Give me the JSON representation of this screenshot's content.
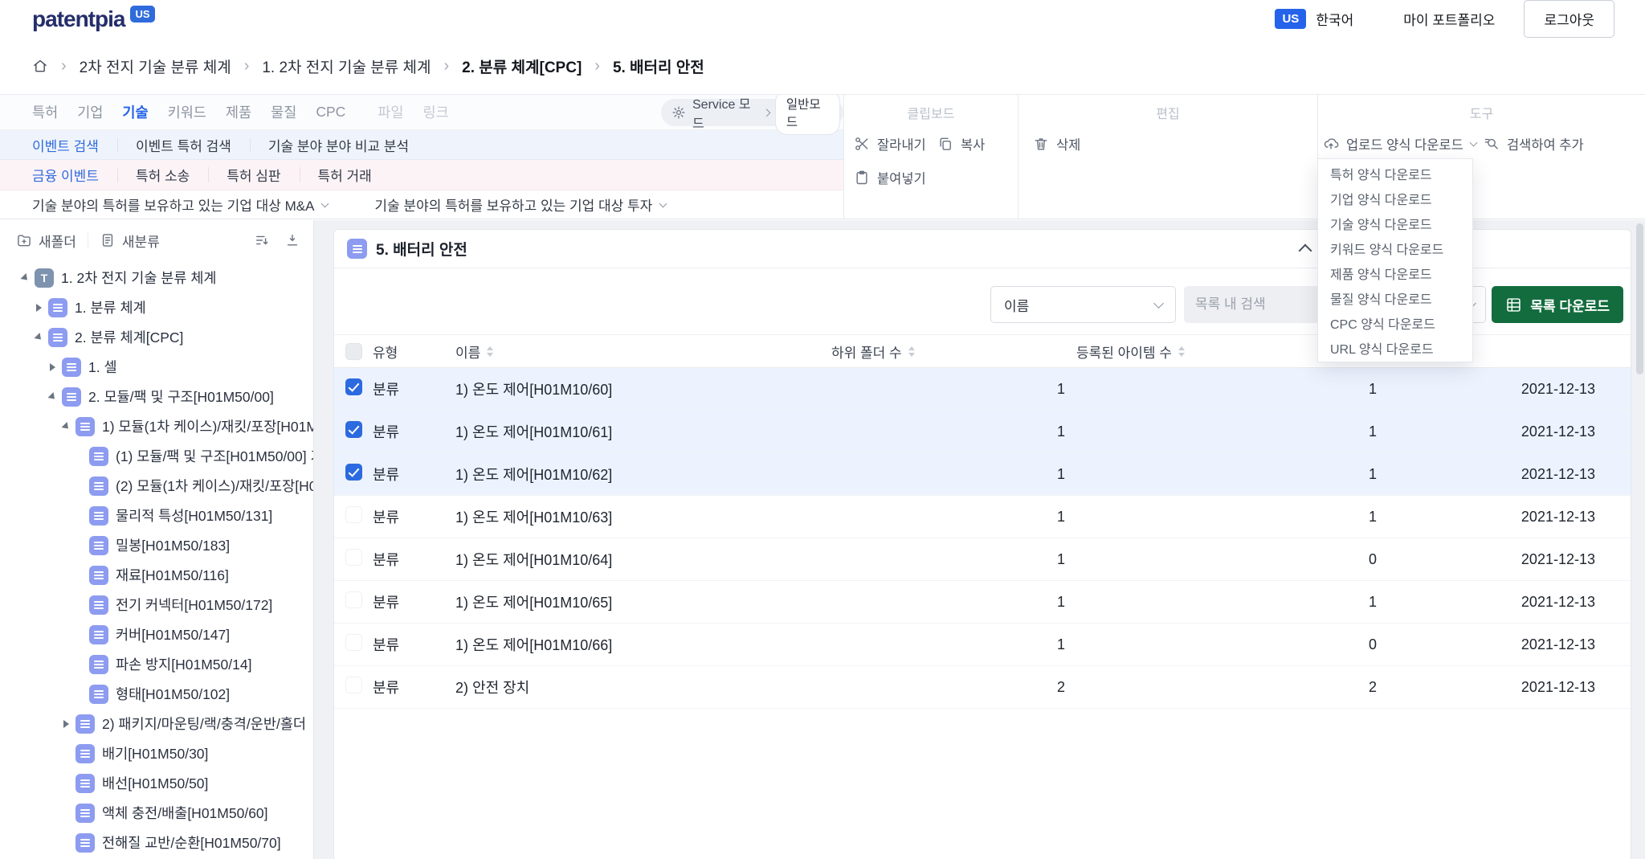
{
  "header": {
    "logo_text": "patentpia",
    "logo_badge": "US",
    "country_badge": "US",
    "language_label": "한국어",
    "portfolio_label": "마이 포트폴리오",
    "logout_label": "로그아웃"
  },
  "breadcrumb": {
    "items": [
      "2차 전지 기술 분류 체계",
      "1. 2차 전지 기술 분류 체계",
      "2. 분류 체계[CPC]",
      "5. 배터리 안전"
    ]
  },
  "toolbar": {
    "tabs": [
      "특허",
      "기업",
      "기술",
      "키워드",
      "제품",
      "물질",
      "CPC"
    ],
    "disabled_tabs": [
      "파일",
      "링크"
    ],
    "active_tab": "기술",
    "service_mode_label": "Service 모드",
    "service_mode_value": "일반모드",
    "clipboard": {
      "title": "클립보드",
      "cut": "잘라내기",
      "copy": "복사",
      "paste": "붙여넣기"
    },
    "edit": {
      "title": "편집",
      "delete": "삭제"
    },
    "tools": {
      "title": "도구",
      "upload_template": "업로드 양식 다운로드",
      "search_add": "검색하여 추가"
    },
    "event_menu": [
      "이벤트 검색",
      "이벤트 특허 검색",
      "기술 분야 분야 비교 분석"
    ],
    "event_active": "이벤트 검색",
    "finance_menu": [
      "금융 이벤트",
      "특허 소송",
      "특허 심판",
      "특허 거래"
    ],
    "finance_active": "금융 이벤트",
    "target_menu": [
      "기술 분야의 특허를 보유하고 있는 기업 대상 M&A",
      "기술 분야의 특허를 보유하고 있는 기업 대상 투자"
    ]
  },
  "download_menu": {
    "items": [
      "특허 양식 다운로드",
      "기업 양식 다운로드",
      "기술 양식 다운로드",
      "키워드 양식 다운로드",
      "제품 양식 다운로드",
      "물질 양식 다운로드",
      "CPC 양식 다운로드",
      "URL 양식 다운로드"
    ]
  },
  "sidebar": {
    "new_folder_label": "새폴더",
    "new_category_label": "새분류",
    "tree": [
      {
        "level": 0,
        "caret": "expanded",
        "icon": "T",
        "label": "1. 2차 전지 기술 분류 체계"
      },
      {
        "level": 1,
        "caret": "collapsed",
        "icon": "E",
        "label": "1. 분류 체계"
      },
      {
        "level": 1,
        "caret": "expanded",
        "icon": "E",
        "label": "2. 분류 체계[CPC]"
      },
      {
        "level": 2,
        "caret": "collapsed",
        "icon": "E",
        "label": "1. 셀"
      },
      {
        "level": 2,
        "caret": "expanded",
        "icon": "E",
        "label": "2. 모듈/팩 및 구조[H01M50/00]"
      },
      {
        "level": 3,
        "caret": "expanded",
        "icon": "E",
        "label": "1) 모듈(1차 케이스)/재킷/포장[H01M"
      },
      {
        "level": 4,
        "caret": "none",
        "icon": "E",
        "label": "(1) 모듈/팩 및 구조[H01M50/00] 기"
      },
      {
        "level": 4,
        "caret": "none",
        "icon": "E",
        "label": "(2) 모듈(1차 케이스)/재킷/포장[H0"
      },
      {
        "level": 4,
        "caret": "none",
        "icon": "E",
        "label": "물리적 특성[H01M50/131]"
      },
      {
        "level": 4,
        "caret": "none",
        "icon": "E",
        "label": "밀봉[H01M50/183]"
      },
      {
        "level": 4,
        "caret": "none",
        "icon": "E",
        "label": "재료[H01M50/116]"
      },
      {
        "level": 4,
        "caret": "none",
        "icon": "E",
        "label": "전기 커넥터[H01M50/172]"
      },
      {
        "level": 4,
        "caret": "none",
        "icon": "E",
        "label": "커버[H01M50/147]"
      },
      {
        "level": 4,
        "caret": "none",
        "icon": "E",
        "label": "파손 방지[H01M50/14]"
      },
      {
        "level": 4,
        "caret": "none",
        "icon": "E",
        "label": "형태[H01M50/102]"
      },
      {
        "level": 3,
        "caret": "collapsed",
        "icon": "E",
        "label": "2) 패키지/마운팅/랙/충격/운반/홀더"
      },
      {
        "level": 3,
        "caret": "none",
        "icon": "E",
        "label": "배기[H01M50/30]"
      },
      {
        "level": 3,
        "caret": "none",
        "icon": "E",
        "label": "배선[H01M50/50]"
      },
      {
        "level": 3,
        "caret": "none",
        "icon": "E",
        "label": "액체 충전/배출[H01M50/60]"
      },
      {
        "level": 3,
        "caret": "none",
        "icon": "E",
        "label": "전해질 교반/순환[H01M50/70]"
      }
    ]
  },
  "main": {
    "section_title": "5. 배터리 안전",
    "filter": {
      "sort_field": "이름",
      "search_placeholder": "목록 내 검색",
      "download_label": "목록 다운로드"
    },
    "table": {
      "headers": {
        "type": "유형",
        "name": "이름",
        "subfolders": "하위 폴더 수",
        "registered": "등록된 아이템 수"
      },
      "rows": [
        {
          "checked": true,
          "type": "분류",
          "name": "1) 온도 제어[H01M10/60]",
          "subfolders": 1,
          "items": 1,
          "date": "2021-12-13"
        },
        {
          "checked": true,
          "type": "분류",
          "name": "1) 온도 제어[H01M10/61]",
          "subfolders": 1,
          "items": 1,
          "date": "2021-12-13"
        },
        {
          "checked": true,
          "type": "분류",
          "name": "1) 온도 제어[H01M10/62]",
          "subfolders": 1,
          "items": 1,
          "date": "2021-12-13"
        },
        {
          "checked": false,
          "type": "분류",
          "name": "1) 온도 제어[H01M10/63]",
          "subfolders": 1,
          "items": 1,
          "date": "2021-12-13"
        },
        {
          "checked": false,
          "type": "분류",
          "name": "1) 온도 제어[H01M10/64]",
          "subfolders": 1,
          "items": 0,
          "date": "2021-12-13"
        },
        {
          "checked": false,
          "type": "분류",
          "name": "1) 온도 제어[H01M10/65]",
          "subfolders": 1,
          "items": 1,
          "date": "2021-12-13"
        },
        {
          "checked": false,
          "type": "분류",
          "name": "1) 온도 제어[H01M10/66]",
          "subfolders": 1,
          "items": 0,
          "date": "2021-12-13"
        },
        {
          "checked": false,
          "type": "분류",
          "name": "2) 안전 장치",
          "subfolders": 2,
          "items": 2,
          "date": "2021-12-13"
        }
      ]
    }
  },
  "colors": {
    "accent_blue": "#2563eb",
    "excel_green": "#136c3e",
    "selected_row": "#edf3fe",
    "tree_icon": "#8d9cf0"
  }
}
